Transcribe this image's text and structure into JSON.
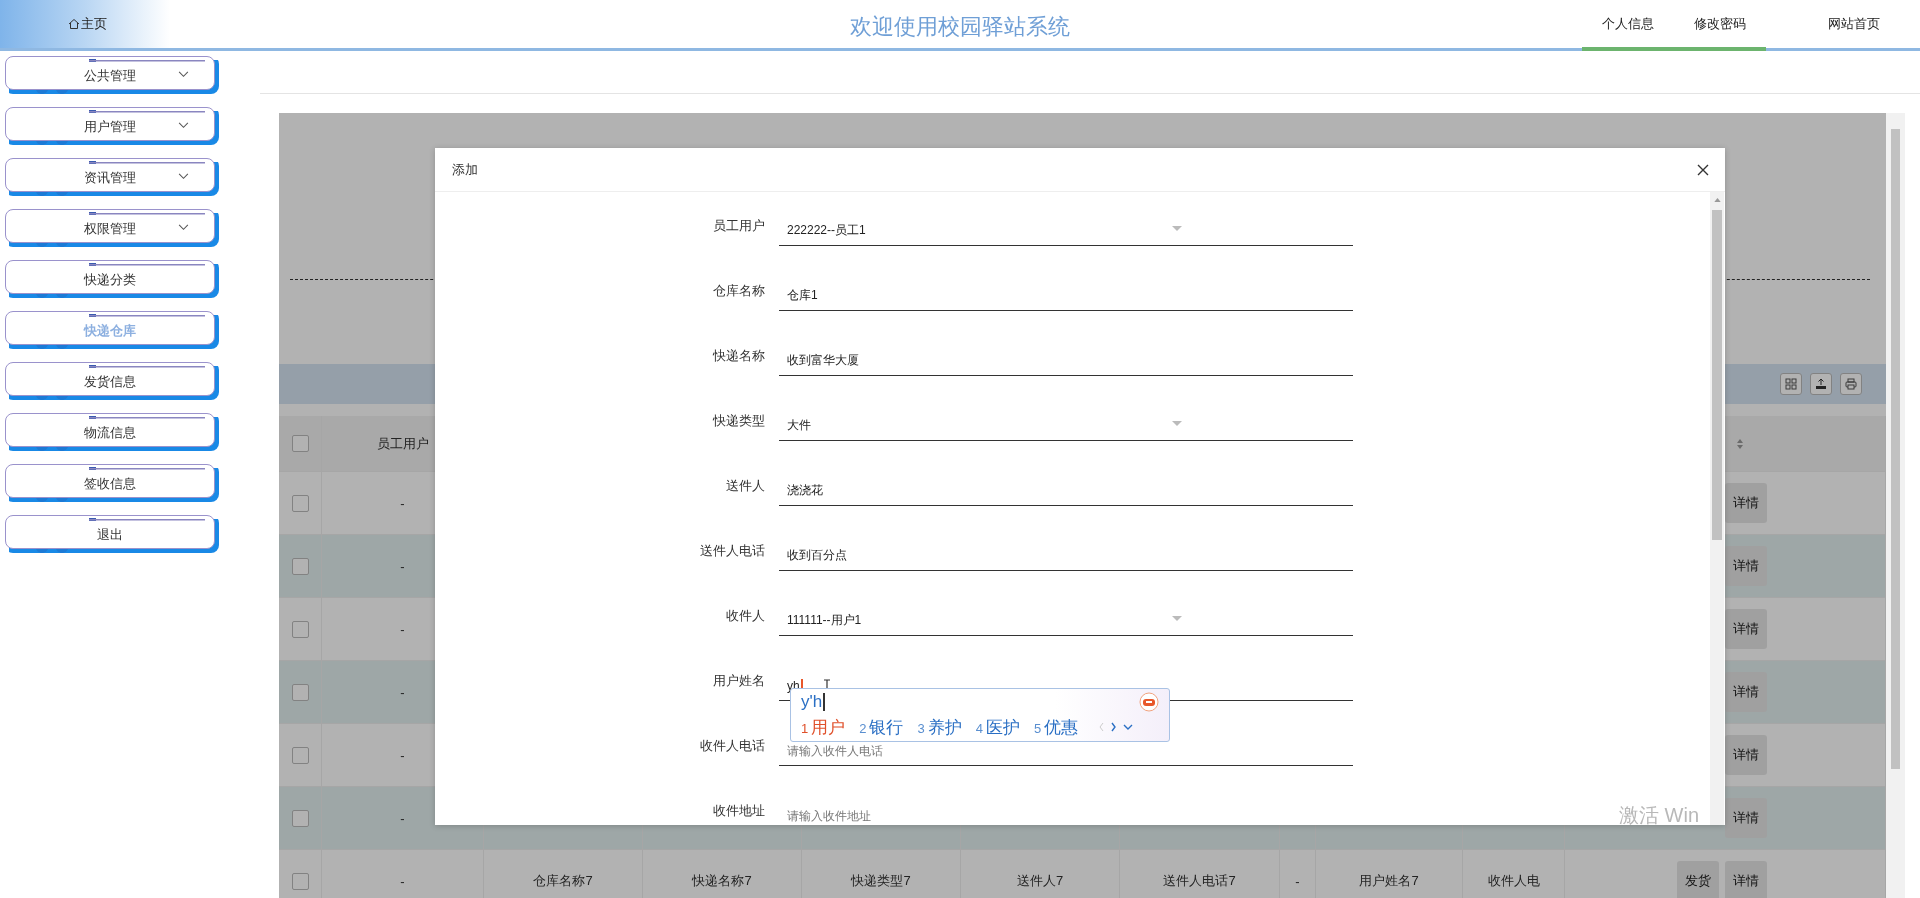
{
  "header": {
    "home": "主页",
    "title": "欢迎使用校园驿站系统",
    "nav": [
      {
        "label": "个人信息",
        "highlighted": true
      },
      {
        "label": "修改密码",
        "highlighted": true
      },
      {
        "label": "网站首页",
        "highlighted": false
      }
    ]
  },
  "sidebar": {
    "items": [
      {
        "label": "公共管理",
        "expandable": true,
        "selected": false
      },
      {
        "label": "用户管理",
        "expandable": true,
        "selected": false
      },
      {
        "label": "资讯管理",
        "expandable": true,
        "selected": false
      },
      {
        "label": "权限管理",
        "expandable": true,
        "selected": false
      },
      {
        "label": "快递分类",
        "expandable": false,
        "selected": false
      },
      {
        "label": "快递仓库",
        "expandable": false,
        "selected": true
      },
      {
        "label": "发货信息",
        "expandable": false,
        "selected": false
      },
      {
        "label": "物流信息",
        "expandable": false,
        "selected": false
      },
      {
        "label": "签收信息",
        "expandable": false,
        "selected": false
      },
      {
        "label": "退出",
        "expandable": false,
        "selected": false
      }
    ]
  },
  "table": {
    "header_checked": false,
    "columns": [
      "员工用户"
    ],
    "rows": [
      {
        "checked": false,
        "cells": [
          "-"
        ],
        "actions": [
          "详情"
        ]
      },
      {
        "checked": false,
        "cells": [
          "-"
        ],
        "actions": [
          "详情"
        ]
      },
      {
        "checked": false,
        "cells": [
          "-"
        ],
        "actions": [
          "详情"
        ]
      },
      {
        "checked": false,
        "cells": [
          "-"
        ],
        "actions": [
          "详情"
        ]
      },
      {
        "checked": false,
        "cells": [
          "-"
        ],
        "actions": [
          "详情"
        ]
      },
      {
        "checked": false,
        "cells": [
          "-"
        ],
        "actions": [
          "详情"
        ]
      },
      {
        "checked": false,
        "cells": [
          "-",
          "仓库名称7",
          "快递名称7",
          "快递类型7",
          "送件人7",
          "送件人电话7",
          "-",
          "用户姓名7",
          "收件人电"
        ],
        "actions": [
          "发货",
          "详情"
        ]
      }
    ]
  },
  "dialog": {
    "title": "添加",
    "fields": [
      {
        "label": "员工用户",
        "kind": "select",
        "value": "222222--员工1"
      },
      {
        "label": "仓库名称",
        "kind": "input",
        "value": "仓库1"
      },
      {
        "label": "快递名称",
        "kind": "input",
        "value": "收到富华大厦"
      },
      {
        "label": "快递类型",
        "kind": "select",
        "value": "大件"
      },
      {
        "label": "送件人",
        "kind": "input",
        "value": "浇浇花"
      },
      {
        "label": "送件人电话",
        "kind": "input",
        "value": "收到百分点"
      },
      {
        "label": "收件人",
        "kind": "select",
        "value": "111111--用户1"
      },
      {
        "label": "用户姓名",
        "kind": "input",
        "value": "yh",
        "composing": true
      },
      {
        "label": "收件人电话",
        "kind": "input",
        "placeholder": "请输入收件人电话"
      },
      {
        "label": "收件地址",
        "kind": "input",
        "placeholder": "请输入收件地址"
      }
    ]
  },
  "ime": {
    "composition": "y'h",
    "candidates": [
      {
        "index": "1",
        "text": "用户",
        "selected": true
      },
      {
        "index": "2",
        "text": "银行",
        "selected": false
      },
      {
        "index": "3",
        "text": "养护",
        "selected": false
      },
      {
        "index": "4",
        "text": "医护",
        "selected": false
      },
      {
        "index": "5",
        "text": "优惠",
        "selected": false
      }
    ]
  },
  "os_notice": "激活 Win"
}
